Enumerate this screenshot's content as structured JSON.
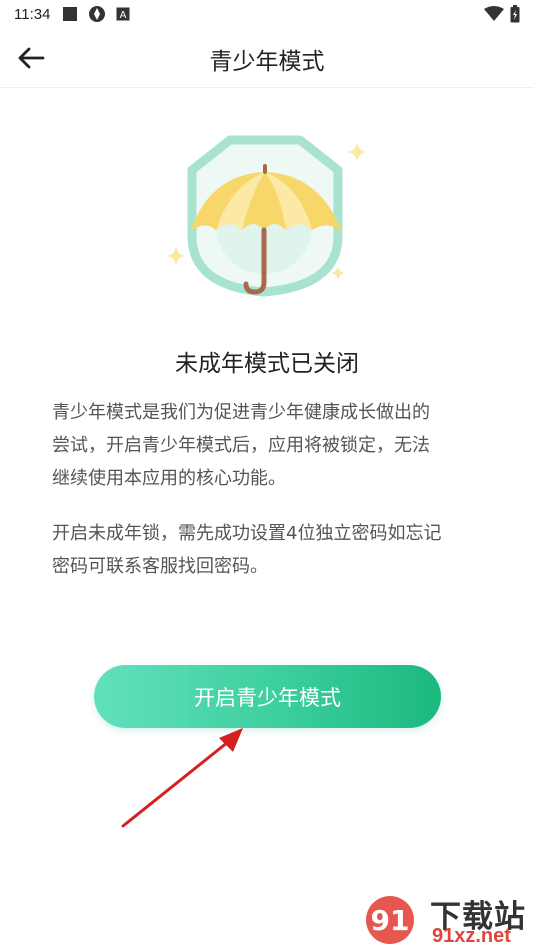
{
  "status_bar": {
    "time": "11:34",
    "left_icons": [
      "square-notification-icon",
      "shutter-icon",
      "a-badge-icon"
    ],
    "right_icons": [
      "wifi-icon",
      "battery-charging-icon"
    ]
  },
  "nav": {
    "back_icon": "arrow-left-icon",
    "title": "青少年模式"
  },
  "illustration": {
    "icon": "umbrella-shield-icon",
    "colors": {
      "shield": "#a7e3d0",
      "umbrella": "#f8d76a",
      "handle": "#a8694a",
      "sparkle": "#fbe7a6"
    }
  },
  "main": {
    "status_heading": "未成年模式已关闭",
    "description_1": [
      "青少年模式是我们为促进青少年健康成长做出的",
      "尝试，开启青少年模式后，应用将被锁定，无法",
      "继续使用本应用的核心功能。"
    ],
    "description_2": [
      "开启未成年锁，需先成功设置4位独立密码如忘记",
      "密码可联系客服找回密码。"
    ],
    "primary_button_label": "开启青少年模式"
  },
  "annotation": {
    "icon": "red-arrow-icon",
    "color": "#d42020"
  },
  "watermark": {
    "logo": "91-logo-icon",
    "text_top": "下载站",
    "text_bottom": "91xz.net"
  },
  "colors": {
    "accent": "#3fd0a0",
    "text_primary": "#222222",
    "text_secondary": "#555555"
  }
}
